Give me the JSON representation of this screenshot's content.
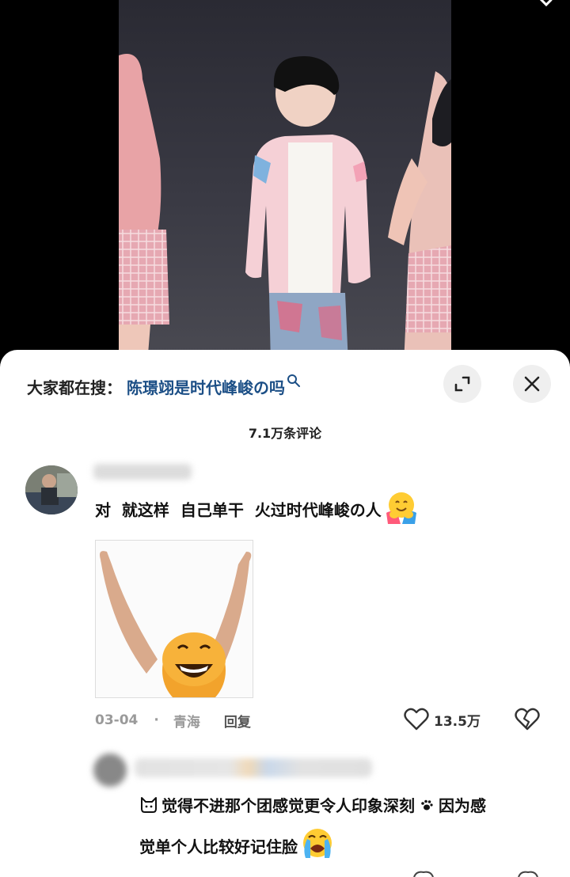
{
  "search": {
    "label": "大家都在搜：",
    "term": "陈璟翊是时代峰峻の吗"
  },
  "comments_header": {
    "count_text": "7.1万条评论"
  },
  "comments": [
    {
      "text": "对  就这样  自己单干  火过时代峰峻の人",
      "emoji": "hugging-face-emoji",
      "sticker": "cheering-orange-sticker",
      "date": "03-04",
      "dot": "·",
      "location": "青海",
      "reply_label": "回复",
      "like_count": "13.5万"
    },
    {
      "line1": "觉得不进那个团感觉更令人印象深刻",
      "line1_tail": "因为感",
      "line2": "觉单个人比较好记住脸",
      "emoji": "crying-face-emoji"
    }
  ],
  "colors": {
    "search_term": "#1c4f86",
    "button_bg": "#efefef",
    "meta_gray": "#9a9a9a",
    "sheet_bg": "#ffffff"
  },
  "icons": {
    "expand": "expand-icon",
    "close": "close-icon",
    "search": "search-icon",
    "like": "heart-icon",
    "dislike": "broken-heart-icon"
  }
}
